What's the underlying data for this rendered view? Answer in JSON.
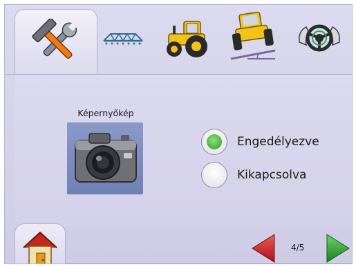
{
  "tabs": [
    {
      "icon": "tools-icon",
      "active": true
    },
    {
      "icon": "boom-icon",
      "active": false
    },
    {
      "icon": "tractor-icon",
      "active": false
    },
    {
      "icon": "vehicle-tilt-icon",
      "active": false
    },
    {
      "icon": "steering-wheel-icon",
      "active": false
    }
  ],
  "screenshot": {
    "label": "Képernyőkép",
    "icon": "camera-icon"
  },
  "options": [
    {
      "label": "Engedélyezve",
      "selected": true
    },
    {
      "label": "Kikapcsolva",
      "selected": false
    }
  ],
  "nav": {
    "page": "4/5",
    "home_icon": "home-icon",
    "prev_icon": "arrow-left-icon",
    "next_icon": "arrow-right-icon"
  },
  "colors": {
    "background": "#d4d1ea",
    "camera_tile": "#7a8bbd",
    "radio_selected": "#3fa83a",
    "prev_arrow": "#c8202a",
    "next_arrow": "#2e9a2e"
  }
}
